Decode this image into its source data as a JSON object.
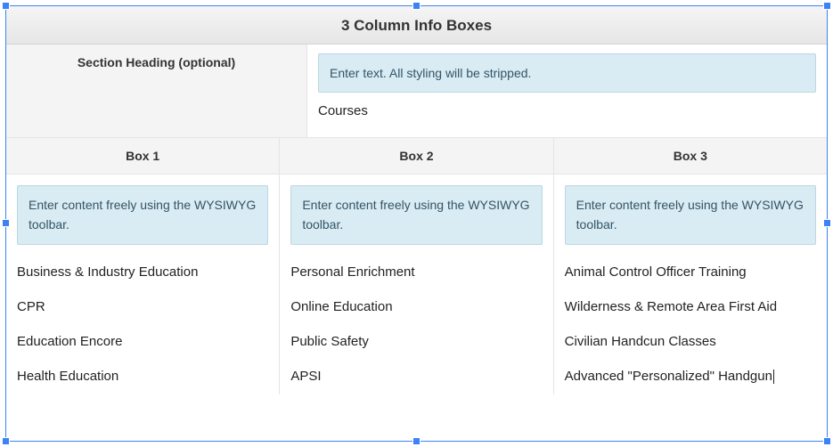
{
  "panel": {
    "title": "3 Column Info Boxes"
  },
  "section": {
    "label": "Section Heading (optional)",
    "hint": "Enter text. All styling will be stripped.",
    "value": "Courses"
  },
  "columns": {
    "hint": "Enter content freely using the WYSIWYG toolbar.",
    "heads": [
      "Box 1",
      "Box 2",
      "Box 3"
    ],
    "items": [
      [
        "Business & Industry Education",
        "CPR",
        "Education Encore",
        "Health Education"
      ],
      [
        "Personal Enrichment",
        "Online Education",
        "Public Safety",
        "APSI"
      ],
      [
        "Animal Control Officer Training",
        "Wilderness & Remote Area First Aid",
        "Civilian Handcun Classes",
        "Advanced \"Personalized\" Handgun"
      ]
    ]
  }
}
